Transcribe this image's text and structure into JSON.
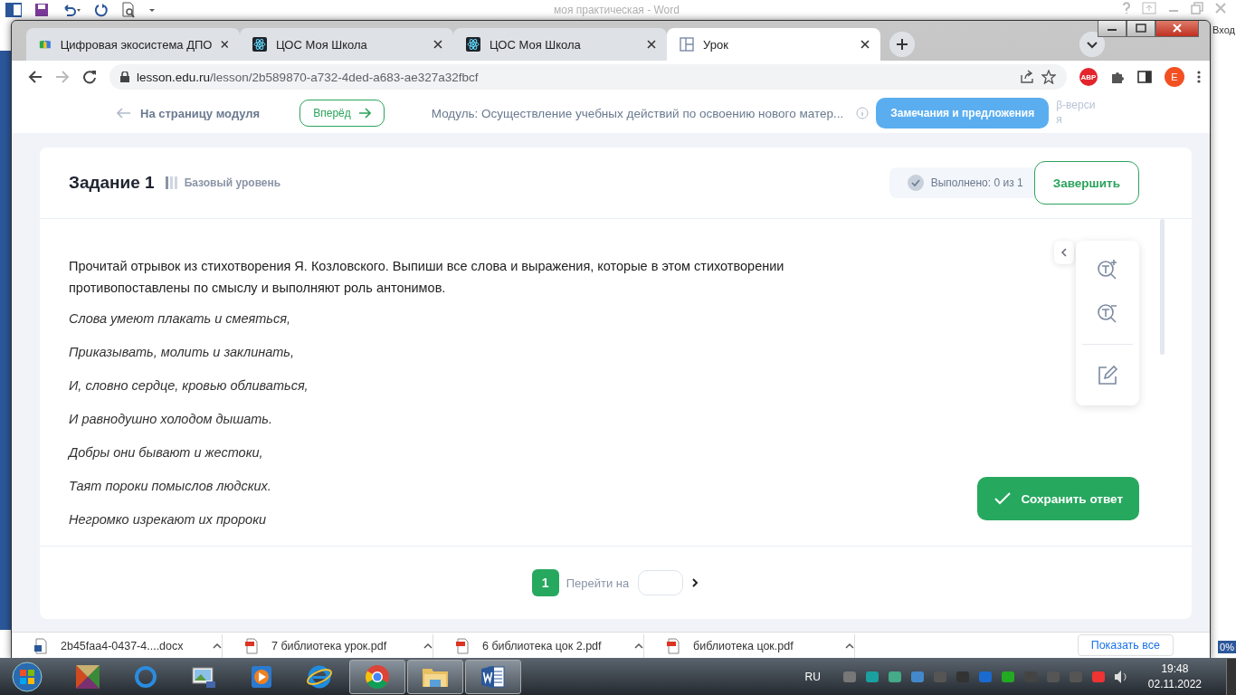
{
  "word": {
    "title": "моя практическая - Word",
    "sign_in": "Вход",
    "zoom": "0%"
  },
  "browser": {
    "tabs": [
      {
        "title": "Цифровая экосистема ДПО",
        "kind": "book",
        "selected": false
      },
      {
        "title": "ЦОС Моя Школа",
        "kind": "atom",
        "selected": false
      },
      {
        "title": "ЦОС Моя Школа",
        "kind": "atom",
        "selected": false
      },
      {
        "title": "Урок",
        "kind": "layout",
        "selected": true
      }
    ],
    "url_host": "lesson.edu.ru",
    "url_path": "/lesson/2b589870-a732-4ded-a683-ae327a32fbcf",
    "adblock": "ABP",
    "profile": "E"
  },
  "lesson_nav": {
    "back": "На страницу модуля",
    "forward": "Вперёд",
    "module": "Модуль: Осуществление учебных действий по освоению нового матер...",
    "feedback": "Замечания и предложения",
    "beta": "β-версия"
  },
  "task": {
    "title": "Задание 1",
    "difficulty": "Базовый уровень",
    "level": 0.33,
    "progress": "Выполнено: 0 из 1",
    "done": false,
    "finish": "Завершить",
    "instruction": "Прочитай отрывок из стихотворения Я. Козловского. Выпиши все слова и выражения, которые в этом стихотворении противопоставлены по смыслу и выполняют роль антонимов.",
    "poem": [
      "Слова умеют плакать и смеяться,",
      "Приказывать, молить и заклинать,",
      "И, словно сердце, кровью обливаться,",
      "И равнодушно холодом дышать.",
      "Добры они бывают и жестоки,",
      "Таят пороки помыслов людских.",
      "Негромко изрекают их пророки"
    ],
    "save": "Сохранить ответ"
  },
  "pagination": {
    "pages": [
      {
        "label": "1",
        "selected": true
      }
    ],
    "goto": "Перейти на"
  },
  "downloads": [
    {
      "name": "2b45faa4-0437-4....docx",
      "kind": "docx"
    },
    {
      "name": "7 библиотека урок.pdf",
      "kind": "pdf"
    },
    {
      "name": "6 библиотека цок 2.pdf",
      "kind": "pdf"
    },
    {
      "name": "библиотека цок.pdf",
      "kind": "pdf"
    }
  ],
  "show_all": "Показать все",
  "taskbar": {
    "apps": [
      {
        "kind": "mosaic",
        "running": false
      },
      {
        "kind": "sync",
        "running": false
      },
      {
        "kind": "photos",
        "running": false
      },
      {
        "kind": "media",
        "running": false
      },
      {
        "kind": "ie",
        "running": false
      },
      {
        "kind": "chrome",
        "running": true
      },
      {
        "kind": "explorer",
        "running": true
      },
      {
        "kind": "word",
        "running": true
      }
    ],
    "language": "RU",
    "time": "19:48",
    "date": "02.11.2022"
  }
}
